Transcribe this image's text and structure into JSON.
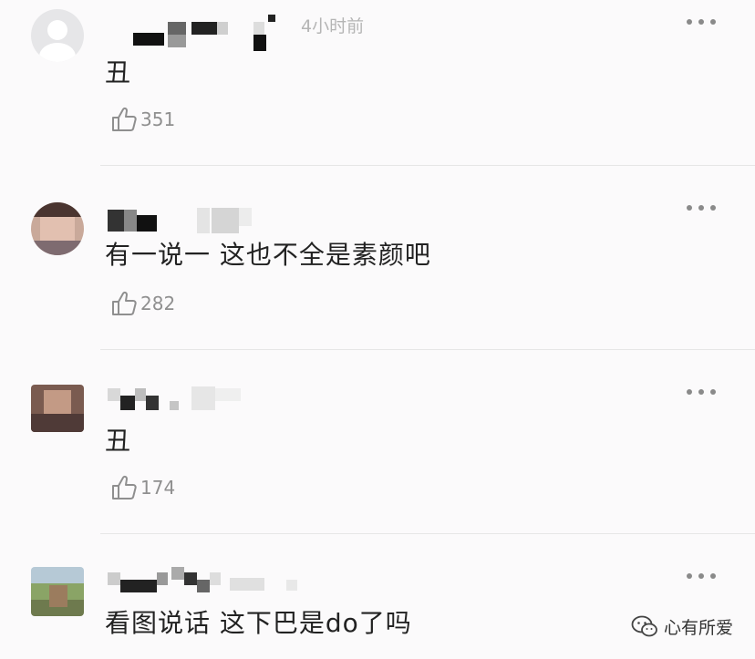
{
  "comments": [
    {
      "time": "4小时前",
      "text": "丑",
      "likes": "351"
    },
    {
      "time": "",
      "text": "有一说一 这也不全是素颜吧",
      "likes": "282"
    },
    {
      "time": "",
      "text": "丑",
      "likes": "174"
    },
    {
      "time": "",
      "text": "看图说话 这下巴是do了吗",
      "likes": ""
    }
  ],
  "watermark": {
    "label": "心有所爱"
  },
  "icons": {
    "like": "thumbs-up-icon",
    "more": "more-dots-icon",
    "watermark": "wechat-logo-icon"
  },
  "colors": {
    "background": "#fbfafb",
    "text": "#222222",
    "meta": "#b5b5b5",
    "divider": "#e6e6e6"
  }
}
